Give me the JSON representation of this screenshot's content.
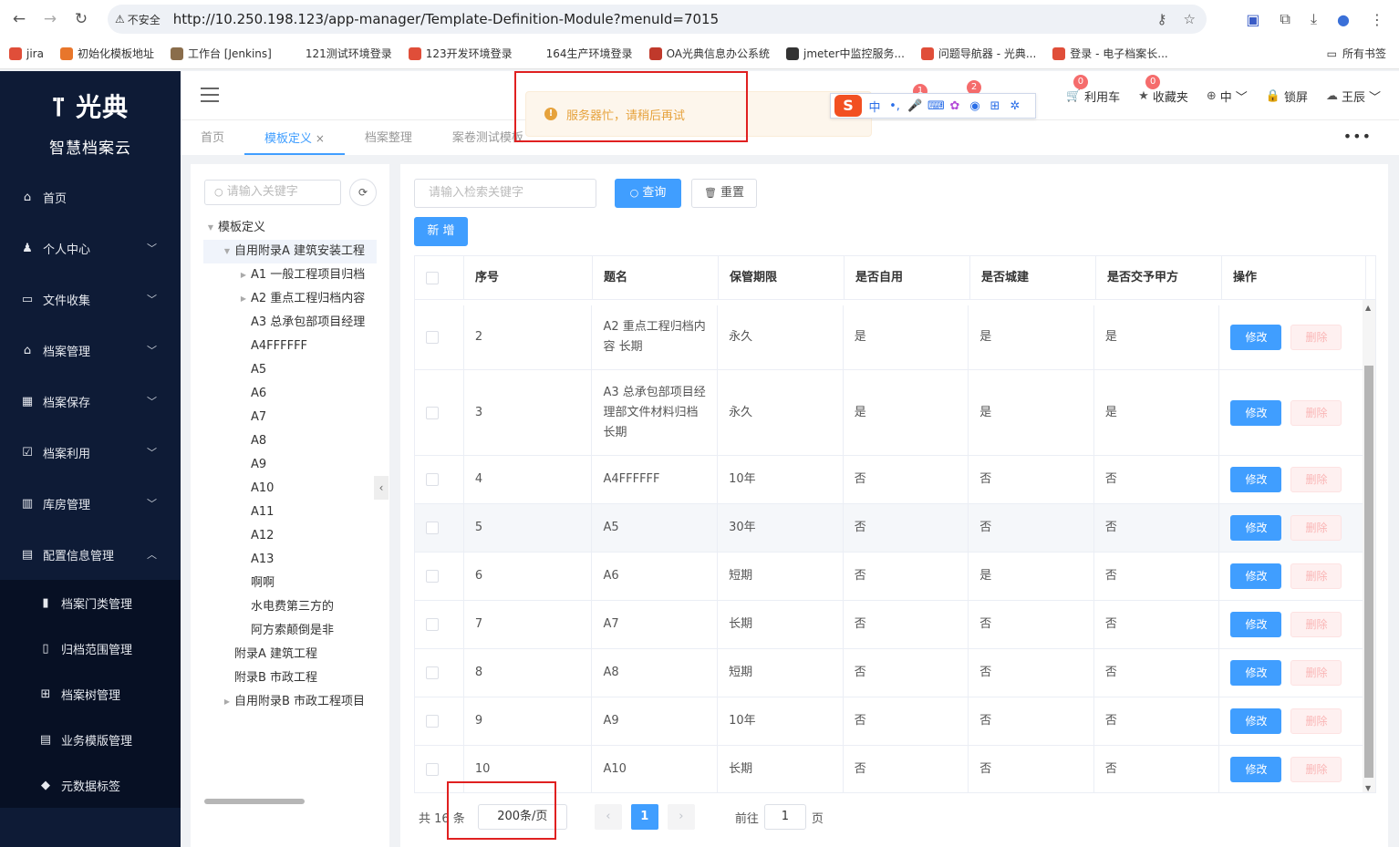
{
  "browser": {
    "insecure_label": "不安全",
    "url": "http://10.250.198.123/app-manager/Template-Definition-Module?menuId=7015",
    "bookmarks": [
      {
        "label": "jira",
        "color": "#e04e39"
      },
      {
        "label": "初始化模板地址",
        "color": "#e8762b"
      },
      {
        "label": "工作台 [Jenkins]",
        "color": "#8a6d4b"
      },
      {
        "label": "121测试环境登录",
        "color": "#ffffff"
      },
      {
        "label": "123开发环境登录",
        "color": "#e04e39"
      },
      {
        "label": "164生产环境登录",
        "color": "#ffffff"
      },
      {
        "label": "OA光典信息办公系统",
        "color": "#c0392b"
      },
      {
        "label": "jmeter中监控服务...",
        "color": "#333333"
      },
      {
        "label": "问题导航器 - 光典...",
        "color": "#e04e39"
      },
      {
        "label": "登录 - 电子档案长...",
        "color": "#e04e39"
      }
    ],
    "all_bookmarks": "所有书签"
  },
  "sidebar": {
    "brand": "光典",
    "subtitle": "智慧档案云",
    "items": [
      {
        "label": "首页",
        "icon": "home-icon",
        "glyph": "⌂",
        "arrow": ""
      },
      {
        "label": "个人中心",
        "icon": "user-icon",
        "glyph": "♟",
        "arrow": "﹀"
      },
      {
        "label": "文件收集",
        "icon": "folder-icon",
        "glyph": "▭",
        "arrow": "﹀"
      },
      {
        "label": "档案管理",
        "icon": "bank-icon",
        "glyph": "⌂",
        "arrow": "﹀"
      },
      {
        "label": "档案保存",
        "icon": "save-icon",
        "glyph": "▦",
        "arrow": "﹀"
      },
      {
        "label": "档案利用",
        "icon": "check-icon",
        "glyph": "☑",
        "arrow": "﹀"
      },
      {
        "label": "库房管理",
        "icon": "warehouse-icon",
        "glyph": "▥",
        "arrow": "﹀"
      },
      {
        "label": "配置信息管理",
        "icon": "config-icon",
        "glyph": "▤",
        "arrow": "︿"
      }
    ],
    "subitems": [
      {
        "label": "档案门类管理",
        "icon": "category-icon",
        "glyph": "▮"
      },
      {
        "label": "归档范围管理",
        "icon": "document-icon",
        "glyph": "▯"
      },
      {
        "label": "档案树管理",
        "icon": "tree-icon",
        "glyph": "⊞"
      },
      {
        "label": "业务模版管理",
        "icon": "template-icon",
        "glyph": "▤"
      },
      {
        "label": "元数据标签",
        "icon": "tag-icon",
        "glyph": "◆"
      }
    ]
  },
  "header": {
    "items": [
      {
        "label": "利用车",
        "badge": "0",
        "icon": "cart-icon",
        "glyph": "🛒"
      },
      {
        "label": "收藏夹",
        "badge": "0",
        "icon": "star-icon",
        "glyph": "★"
      },
      {
        "label": "中",
        "badge": "",
        "icon": "language-icon",
        "glyph": "⊕"
      },
      {
        "label": "锁屏",
        "badge": "",
        "icon": "lock-icon",
        "glyph": "🔒"
      },
      {
        "label": "王辰",
        "badge": "",
        "icon": "cloud-avatar-icon",
        "glyph": "☁"
      }
    ],
    "hidden_badges": [
      "1",
      "2"
    ]
  },
  "tabs": [
    {
      "label": "首页",
      "active": false
    },
    {
      "label": "模板定义",
      "active": true
    },
    {
      "label": "档案整理",
      "active": false
    },
    {
      "label": "案卷测试模板",
      "active": false
    }
  ],
  "toast": {
    "message": "服务器忙，请稍后再试"
  },
  "ime": {
    "logo": "S",
    "mode": "中"
  },
  "tree": {
    "search_placeholder": "请输入关键字",
    "nodes": [
      {
        "label": "模板定义",
        "depth": 0,
        "caret": "▼",
        "selected": false
      },
      {
        "label": "自用附录A 建筑安装工程",
        "depth": 1,
        "caret": "▼",
        "selected": true
      },
      {
        "label": "A1 一般工程项目归档",
        "depth": 2,
        "caret": "▶",
        "selected": false
      },
      {
        "label": "A2 重点工程归档内容",
        "depth": 2,
        "caret": "▶",
        "selected": false
      },
      {
        "label": "A3 总承包部项目经理",
        "depth": 2,
        "caret": "",
        "selected": false
      },
      {
        "label": "A4FFFFFF",
        "depth": 2,
        "caret": "",
        "selected": false
      },
      {
        "label": "A5",
        "depth": 2,
        "caret": "",
        "selected": false
      },
      {
        "label": "A6",
        "depth": 2,
        "caret": "",
        "selected": false
      },
      {
        "label": "A7",
        "depth": 2,
        "caret": "",
        "selected": false
      },
      {
        "label": "A8",
        "depth": 2,
        "caret": "",
        "selected": false
      },
      {
        "label": "A9",
        "depth": 2,
        "caret": "",
        "selected": false
      },
      {
        "label": "A10",
        "depth": 2,
        "caret": "",
        "selected": false
      },
      {
        "label": "A11",
        "depth": 2,
        "caret": "",
        "selected": false
      },
      {
        "label": "A12",
        "depth": 2,
        "caret": "",
        "selected": false
      },
      {
        "label": "A13",
        "depth": 2,
        "caret": "",
        "selected": false
      },
      {
        "label": "啊啊",
        "depth": 2,
        "caret": "",
        "selected": false
      },
      {
        "label": "水电费第三方的",
        "depth": 2,
        "caret": "",
        "selected": false
      },
      {
        "label": "阿方索颠倒是非",
        "depth": 2,
        "caret": "",
        "selected": false
      },
      {
        "label": "附录A 建筑工程",
        "depth": 1,
        "caret": "",
        "selected": false
      },
      {
        "label": "附录B 市政工程",
        "depth": 1,
        "caret": "",
        "selected": false
      },
      {
        "label": "自用附录B 市政工程项目",
        "depth": 1,
        "caret": "▶",
        "selected": false
      }
    ]
  },
  "toolbar": {
    "search_placeholder": "请输入检索关键字",
    "query_label": "查询",
    "reset_label": "重置",
    "add_label": "新 增"
  },
  "table": {
    "columns": [
      "序号",
      "题名",
      "保管期限",
      "是否自用",
      "是否城建",
      "是否交予甲方",
      "操作"
    ],
    "edit_label": "修改",
    "delete_label": "删除",
    "rows": [
      {
        "no": "2",
        "title": "A2 重点工程归档内容 长期",
        "period": "永久",
        "self": "是",
        "city": "是",
        "party": "是",
        "lines": 2
      },
      {
        "no": "3",
        "title": "A3 总承包部项目经理部文件材料归档 长期",
        "period": "永久",
        "self": "是",
        "city": "是",
        "party": "是",
        "lines": 3
      },
      {
        "no": "4",
        "title": "A4FFFFFF",
        "period": "10年",
        "self": "否",
        "city": "否",
        "party": "否",
        "lines": 1
      },
      {
        "no": "5",
        "title": "A5",
        "period": "30年",
        "self": "否",
        "city": "否",
        "party": "否",
        "lines": 1
      },
      {
        "no": "6",
        "title": "A6",
        "period": "短期",
        "self": "否",
        "city": "是",
        "party": "否",
        "lines": 1
      },
      {
        "no": "7",
        "title": "A7",
        "period": "长期",
        "self": "否",
        "city": "否",
        "party": "否",
        "lines": 1
      },
      {
        "no": "8",
        "title": "A8",
        "period": "短期",
        "self": "否",
        "city": "否",
        "party": "否",
        "lines": 1
      },
      {
        "no": "9",
        "title": "A9",
        "period": "10年",
        "self": "否",
        "city": "否",
        "party": "否",
        "lines": 1
      },
      {
        "no": "10",
        "title": "A10",
        "period": "长期",
        "self": "否",
        "city": "否",
        "party": "否",
        "lines": 1
      }
    ]
  },
  "pagination": {
    "total_prefix": "共 16 条",
    "page_size": "200条/页",
    "current_page": "1",
    "goto_prefix": "前往",
    "goto_value": "1",
    "goto_suffix": "页"
  }
}
